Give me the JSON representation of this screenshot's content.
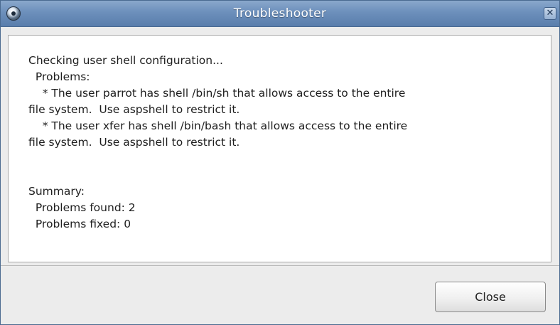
{
  "window": {
    "title": "Troubleshooter",
    "close_glyph": "✕",
    "icon": "troubleshooter-app-icon"
  },
  "report": {
    "lines": [
      "Checking user shell configuration...",
      "  Problems:",
      "    * The user parrot has shell /bin/sh that allows access to the entire",
      "file system.  Use aspshell to restrict it.",
      "    * The user xfer has shell /bin/bash that allows access to the entire",
      "file system.  Use aspshell to restrict it.",
      "",
      "",
      "Summary:",
      "  Problems found: 2",
      "  Problems fixed: 0"
    ]
  },
  "buttons": {
    "close_label": "Close"
  },
  "colors": {
    "titlebar": "#6c8fbb",
    "window_bg": "#ececec",
    "content_bg": "#ffffff",
    "text": "#1e1e1e"
  }
}
